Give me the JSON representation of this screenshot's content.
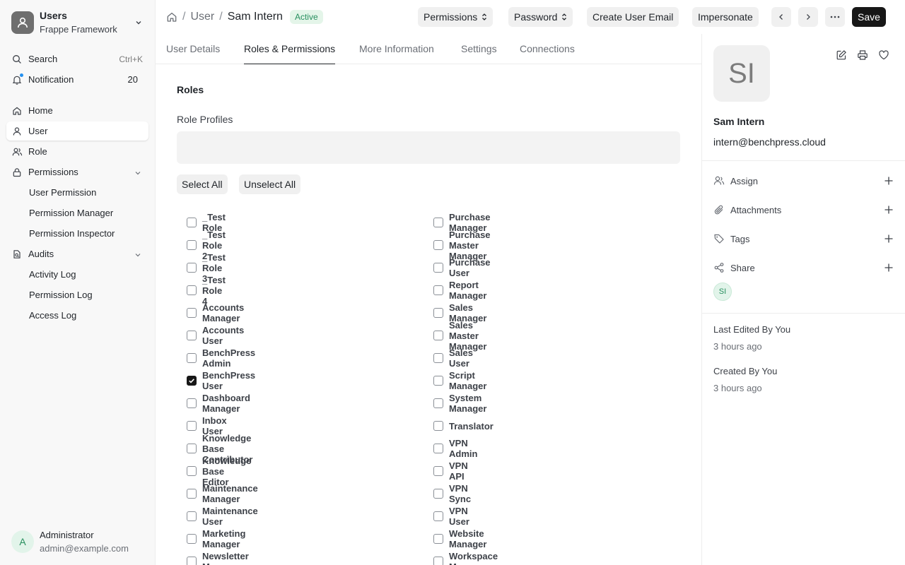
{
  "workspace": {
    "title": "Users",
    "subtitle": "Frappe Framework"
  },
  "sidebar": {
    "search": {
      "label": "Search",
      "shortcut": "Ctrl+K"
    },
    "notification": {
      "label": "Notification",
      "count": "20"
    },
    "items": [
      {
        "label": "Home",
        "icon": "home-icon"
      },
      {
        "label": "User",
        "icon": "user-icon",
        "active": true
      },
      {
        "label": "Role",
        "icon": "users-icon"
      },
      {
        "label": "Permissions",
        "icon": "lock-icon",
        "expandable": true
      },
      {
        "label": "User Permission",
        "sub": true
      },
      {
        "label": "Permission Manager",
        "sub": true
      },
      {
        "label": "Permission Inspector",
        "sub": true
      },
      {
        "label": "Audits",
        "icon": "audit-icon",
        "expandable": true
      },
      {
        "label": "Activity Log",
        "sub": true
      },
      {
        "label": "Permission Log",
        "sub": true
      },
      {
        "label": "Access Log",
        "sub": true
      }
    ]
  },
  "current_user": {
    "initial": "A",
    "name": "Administrator",
    "email": "admin@example.com"
  },
  "breadcrumb": {
    "parent": "User",
    "current": "Sam Intern",
    "status": "Active"
  },
  "header_buttons": {
    "permissions": "Permissions",
    "password": "Password",
    "create_email": "Create User Email",
    "impersonate": "Impersonate",
    "save": "Save"
  },
  "tabs": [
    "User Details",
    "Roles & Permissions",
    "More Information",
    "Settings",
    "Connections"
  ],
  "active_tab": "Roles & Permissions",
  "roles_section": {
    "title": "Roles",
    "role_profiles_label": "Role Profiles",
    "role_profiles_value": "",
    "select_all": "Select All",
    "unselect_all": "Unselect All"
  },
  "roles_left": [
    {
      "name": "_Test Role",
      "checked": false
    },
    {
      "name": "_Test Role 2",
      "checked": false
    },
    {
      "name": "_Test Role 3",
      "checked": false
    },
    {
      "name": "_Test Role 4",
      "checked": false
    },
    {
      "name": "Accounts Manager",
      "checked": false
    },
    {
      "name": "Accounts User",
      "checked": false
    },
    {
      "name": "BenchPress Admin",
      "checked": false
    },
    {
      "name": "BenchPress User",
      "checked": true
    },
    {
      "name": "Dashboard Manager",
      "checked": false
    },
    {
      "name": "Inbox User",
      "checked": false
    },
    {
      "name": "Knowledge Base Contributor",
      "checked": false
    },
    {
      "name": "Knowledge Base Editor",
      "checked": false
    },
    {
      "name": "Maintenance Manager",
      "checked": false
    },
    {
      "name": "Maintenance User",
      "checked": false
    },
    {
      "name": "Marketing Manager",
      "checked": false
    },
    {
      "name": "Newsletter Manager",
      "checked": false
    }
  ],
  "roles_right": [
    {
      "name": "Purchase Manager",
      "checked": false
    },
    {
      "name": "Purchase Master Manager",
      "checked": false
    },
    {
      "name": "Purchase User",
      "checked": false
    },
    {
      "name": "Report Manager",
      "checked": false
    },
    {
      "name": "Sales Manager",
      "checked": false
    },
    {
      "name": "Sales Master Manager",
      "checked": false
    },
    {
      "name": "Sales User",
      "checked": false
    },
    {
      "name": "Script Manager",
      "checked": false
    },
    {
      "name": "System Manager",
      "checked": false
    },
    {
      "name": "Translator",
      "checked": false
    },
    {
      "name": "VPN Admin",
      "checked": false
    },
    {
      "name": "VPN API",
      "checked": false
    },
    {
      "name": "VPN Sync",
      "checked": false
    },
    {
      "name": "VPN User",
      "checked": false
    },
    {
      "name": "Website Manager",
      "checked": false
    },
    {
      "name": "Workspace Manager",
      "checked": false
    }
  ],
  "profile": {
    "initials": "SI",
    "name": "Sam Intern",
    "email": "intern@benchpress.cloud",
    "actions": [
      {
        "label": "Assign",
        "icon": "assign-icon"
      },
      {
        "label": "Attachments",
        "icon": "paperclip-icon"
      },
      {
        "label": "Tags",
        "icon": "tag-icon"
      },
      {
        "label": "Share",
        "icon": "share-icon"
      }
    ],
    "shared_with_initials": "SI",
    "last_edited": "Last Edited By You",
    "last_edited_time": "3 hours ago",
    "created": "Created By You",
    "created_time": "3 hours ago"
  },
  "colors": {
    "accent": "#171717",
    "status_green": "#278f5e",
    "notification_dot": "#2490ef"
  }
}
